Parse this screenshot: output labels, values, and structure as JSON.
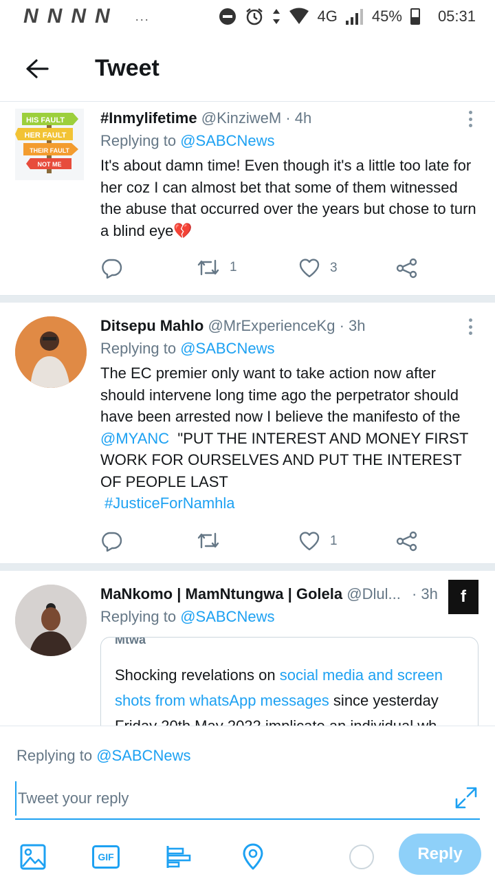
{
  "status_bar": {
    "notif_glyph": "N",
    "dots": "...",
    "network": "4G",
    "battery_pct": "45%",
    "battery_level": 0.45,
    "time": "05:31"
  },
  "header": {
    "title": "Tweet"
  },
  "tweets": [
    {
      "name": "#Inmylifetime",
      "handle": "@KinziweM",
      "sep": "·",
      "time": "4h",
      "replying_prefix": "Replying to",
      "replying_handle": "@SABCNews",
      "text": "It's about damn time! Even though it's a little too late for her coz I can almost bet that some of them witnessed the abuse that occurred over the years but chose to turn a blind eye",
      "emoji": "💔",
      "avatar_signs": [
        "HIS FAULT",
        "HER FAULT",
        "THEIR FAULT",
        "NOT ME"
      ],
      "retweets": "1",
      "likes": "3"
    },
    {
      "name": "Ditsepu Mahlo",
      "handle": "@MrExperienceKg",
      "sep": "·",
      "time": "3h",
      "replying_prefix": "Replying to",
      "replying_handle": "@SABCNews",
      "text_a": "The EC premier only want to take action now after should intervene long time ago the perpetrator should have been arrested now I believe the manifesto of the ",
      "mention": "@MYANC",
      "text_b": "  \"PUT THE INTEREST AND MONEY FIRST WORK FOR OURSELVES AND PUT THE INTEREST OF PEOPLE LAST",
      "hashtag": "#JusticeForNamhla",
      "retweets": "",
      "likes": "1"
    },
    {
      "name": "MaNkomo | MamNtungwa | Golela",
      "handle": "@Dlul...",
      "sep": "·",
      "time": "3h",
      "replying_prefix": "Replying to",
      "replying_handle": "@SABCNews",
      "quote_cut": "Mtwa",
      "quote_a": "Shocking revelations on ",
      "quote_link": "social media and screen shots from whatsApp messages",
      "quote_b": " since yesterday Friday 20th May 2022 implicate an individual wh",
      "fb_badge": "f"
    }
  ],
  "composer": {
    "replying_prefix": "Replying to",
    "replying_handle": "@SABCNews",
    "placeholder": "Tweet your reply",
    "gif_label": "GIF",
    "reply_label": "Reply"
  },
  "icons": {
    "back": "back-arrow-icon",
    "more": "more-vertical-icon",
    "reply": "reply-bubble-icon",
    "retweet": "retweet-icon",
    "like": "heart-icon",
    "share": "share-icon",
    "image": "image-icon",
    "poll": "poll-icon",
    "location": "location-pin-icon",
    "expand": "expand-icon"
  },
  "colors": {
    "accent": "#1da1f2",
    "reply_button_disabled": "#8ed0f9",
    "muted": "#657786"
  }
}
